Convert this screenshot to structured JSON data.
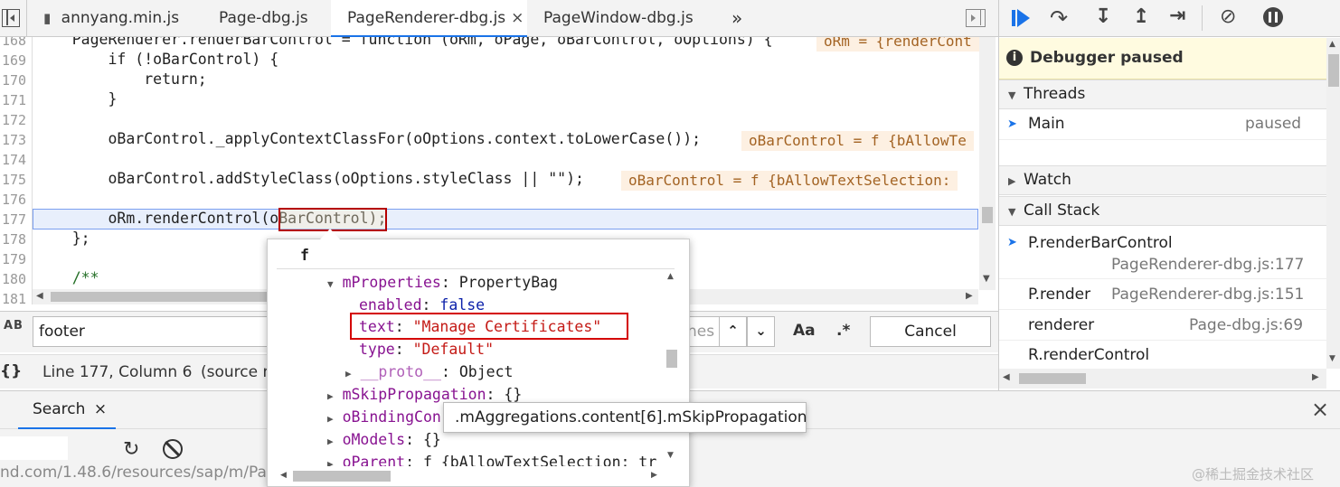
{
  "tabs": [
    {
      "label": "annyang.min.js"
    },
    {
      "label": "Page-dbg.js"
    },
    {
      "label": "PageRenderer-dbg.js",
      "close": "×"
    },
    {
      "label": "PageWindow-dbg.js"
    }
  ],
  "tabs_overflow": "»",
  "editor": {
    "lines": [
      {
        "n": "168",
        "text": "    PageRenderer.renderBarControl = function (oRm, oPage, oBarControl, oOptions) {",
        "inline": "oRm = {renderCont"
      },
      {
        "n": "169",
        "text": "        if (!oBarControl) {"
      },
      {
        "n": "170",
        "text": "            return;"
      },
      {
        "n": "171",
        "text": "        }"
      },
      {
        "n": "172",
        "text": ""
      },
      {
        "n": "173",
        "text": "        oBarControl._applyContextClassFor(oOptions.context.toLowerCase());",
        "inline": "oBarControl = f {bAllowTe"
      },
      {
        "n": "174",
        "text": ""
      },
      {
        "n": "175",
        "text": "        oBarControl.addStyleClass(oOptions.styleClass || \"\");",
        "inline": "oBarControl = f {bAllowTextSelection:"
      },
      {
        "n": "176",
        "text": ""
      },
      {
        "n": "177",
        "text": "        oRm.renderControl(oBarControl);"
      },
      {
        "n": "178",
        "text": "    };"
      },
      {
        "n": "179",
        "text": ""
      },
      {
        "n": "180",
        "text": "    /**"
      },
      {
        "n": "181",
        "text": ""
      }
    ]
  },
  "search": {
    "icon": "AB",
    "value": "footer",
    "hidden_text": "hes",
    "match_case": "Aa",
    "regex": ".*",
    "cancel": "Cancel"
  },
  "status": {
    "braces": "{}",
    "text": "Line 177, Column 6",
    "source": "(source m"
  },
  "drawer": {
    "tab": "Search",
    "tab_close": "×",
    "url": "nd.com/1.48.6/resources/sap/m/Pag",
    "close": "×"
  },
  "debugger": {
    "banner": "Debugger paused",
    "threads_title": "Threads",
    "thread_name": "Main",
    "thread_status": "paused",
    "watch_title": "Watch",
    "callstack_title": "Call Stack",
    "frames": [
      {
        "name": "P.renderBarControl",
        "loc": "PageRenderer-dbg.js:177"
      },
      {
        "name": "P.render",
        "loc": "PageRenderer-dbg.js:151"
      },
      {
        "name": "renderer",
        "loc": "Page-dbg.js:69"
      },
      {
        "name": "R.renderControl",
        "loc": ""
      }
    ]
  },
  "popover": {
    "header": "f",
    "rows": [
      {
        "key": "mProperties",
        "sep": ": ",
        "val": "PropertyBag"
      },
      {
        "key": "enabled",
        "sep": ": ",
        "val": "false"
      },
      {
        "key": "text",
        "sep": ": ",
        "val": "\"Manage Certificates\""
      },
      {
        "key": "type",
        "sep": ": ",
        "val": "\"Default\""
      },
      {
        "key": "__proto__",
        "sep": ": ",
        "val": "Object"
      },
      {
        "key": "mSkipPropagation",
        "sep": ": ",
        "val": "{}"
      },
      {
        "key": "oBindingCon",
        "sep": "",
        "val": ""
      },
      {
        "key": "oModels",
        "sep": ": ",
        "val": "{}"
      },
      {
        "key": "oParent",
        "sep": ": ",
        "val": "f {bAllowTextSelection: tr"
      }
    ]
  },
  "tooltip": ".mAggregations.content[6].mSkipPropagation",
  "watermark": "@稀土掘金技术社区",
  "colors": {
    "accent": "#1a73e8",
    "highlight": "#cc0000",
    "banner_bg": "#fffbe0"
  }
}
